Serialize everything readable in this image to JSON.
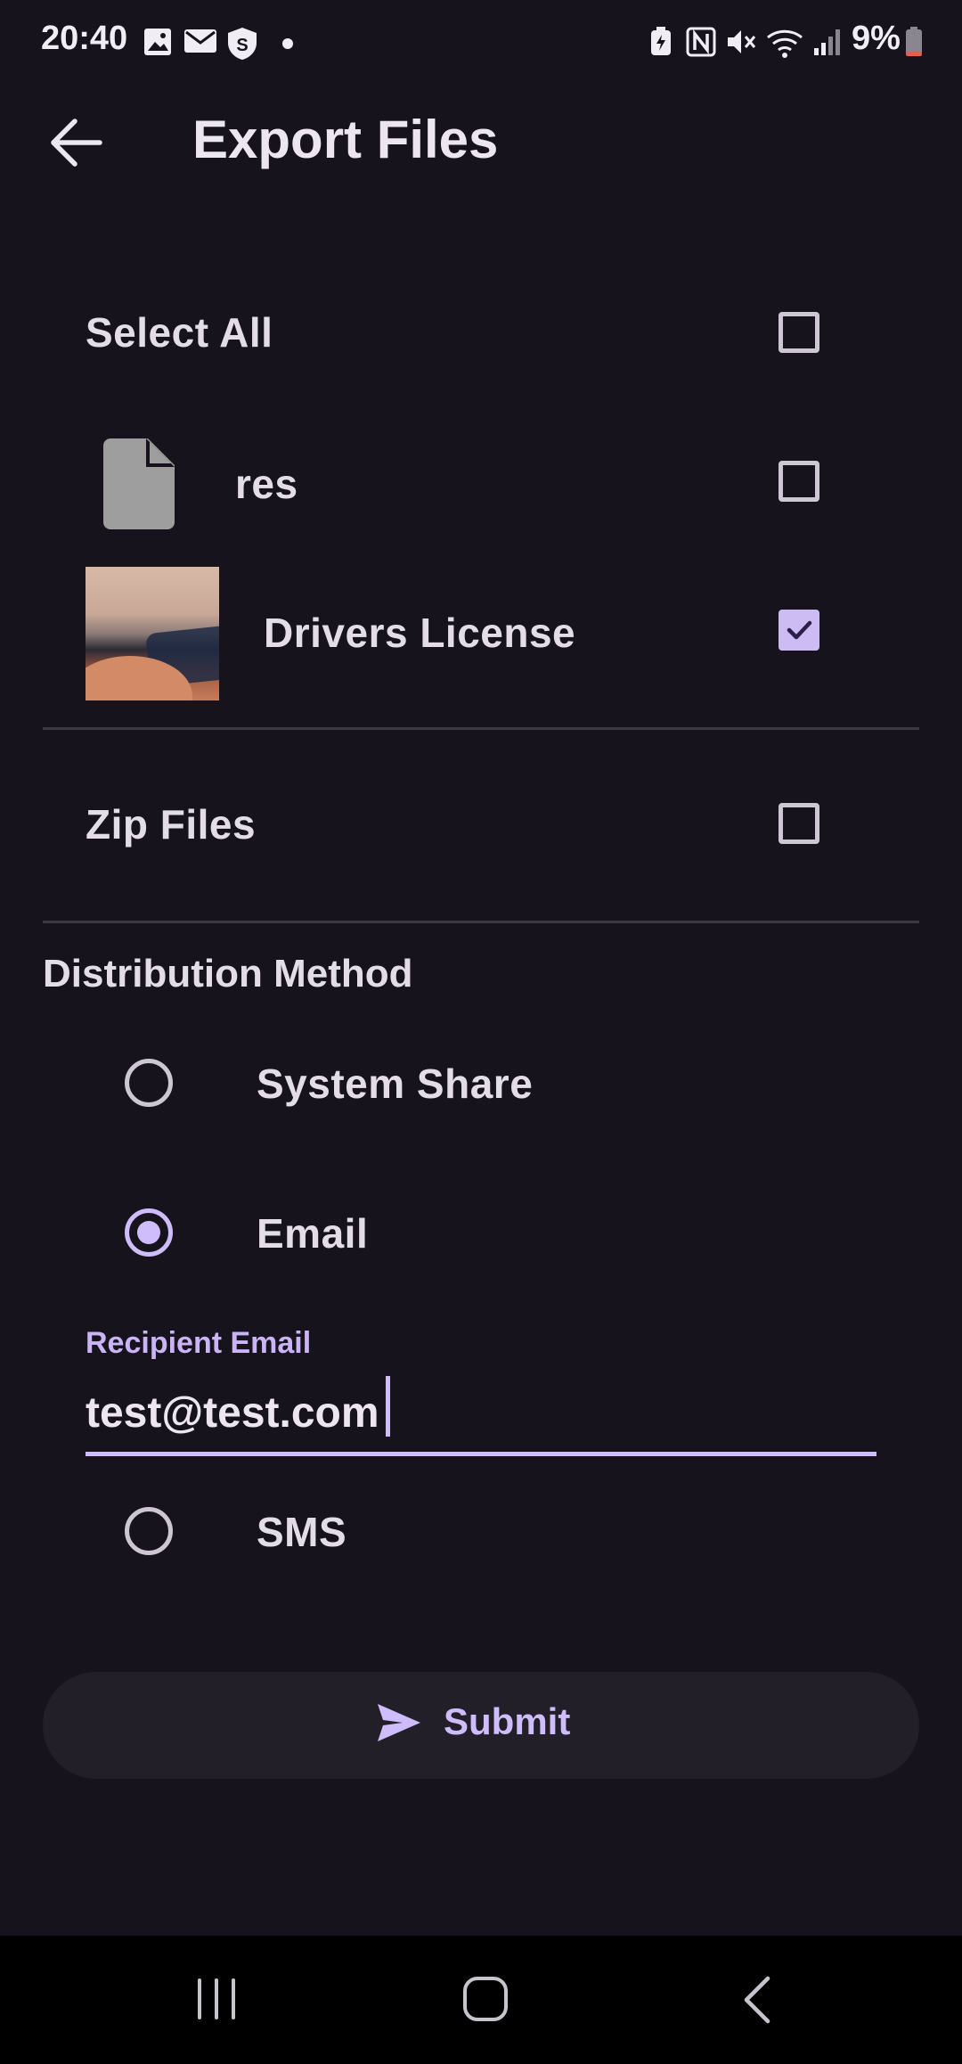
{
  "status_bar": {
    "time": "20:40",
    "battery_percent": "9%",
    "icons": [
      "image-icon",
      "mail-icon",
      "shield-s-icon",
      "dot-icon",
      "battery-saver-icon",
      "nfc-icon",
      "mute-icon",
      "wifi-icon",
      "signal-icon",
      "battery-icon"
    ]
  },
  "header": {
    "title": "Export Files",
    "back_icon": "arrow-left-icon"
  },
  "files": {
    "select_all_label": "Select All",
    "select_all_checked": false,
    "items": [
      {
        "name": "res",
        "icon": "file-icon",
        "checked": false
      },
      {
        "name": "Drivers License",
        "icon": "image-thumbnail",
        "checked": true
      }
    ]
  },
  "zip": {
    "label": "Zip Files",
    "checked": false
  },
  "distribution": {
    "title": "Distribution Method",
    "options": [
      {
        "label": "System Share",
        "selected": false
      },
      {
        "label": "Email",
        "selected": true
      },
      {
        "label": "SMS",
        "selected": false
      }
    ],
    "recipient_label": "Recipient Email",
    "recipient_value": "test@test.com"
  },
  "submit": {
    "label": "Submit",
    "icon": "send-icon"
  },
  "nav": {
    "icons": [
      "recents-icon",
      "home-icon",
      "back-nav-icon"
    ]
  },
  "colors": {
    "background": "#16131c",
    "accent": "#cfbcfa",
    "navbar": "#000000"
  }
}
